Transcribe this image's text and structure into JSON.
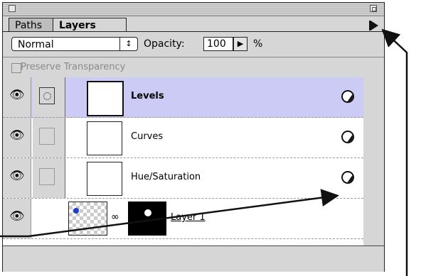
{
  "tabs": [
    {
      "label": "Paths",
      "active": false
    },
    {
      "label": "Layers",
      "active": true
    }
  ],
  "blend_mode": {
    "value": "Normal",
    "arrows": "↕"
  },
  "opacity": {
    "label": "Opacity:",
    "value": "100",
    "arrow": "▶",
    "unit": "%"
  },
  "preserve_transparency": {
    "label": "Preserve Transparency",
    "checked": false,
    "enabled": false
  },
  "layers": [
    {
      "name": "Levels",
      "selected": true,
      "type": "adjustment"
    },
    {
      "name": "Curves",
      "selected": false,
      "type": "adjustment"
    },
    {
      "name": "Hue/Saturation",
      "selected": false,
      "type": "adjustment"
    },
    {
      "name": "Layer 1",
      "selected": false,
      "type": "image-with-mask"
    }
  ],
  "icons": {
    "visibility": "eye-icon",
    "adjustment": "adjustment-layer-icon",
    "link": "chain-link-icon",
    "menu": "palette-menu-triangle-icon"
  },
  "colors": {
    "selected_row": "#cbcbf5",
    "panel": "#d6d6d6",
    "layer_dot": "#1c3fcf"
  }
}
